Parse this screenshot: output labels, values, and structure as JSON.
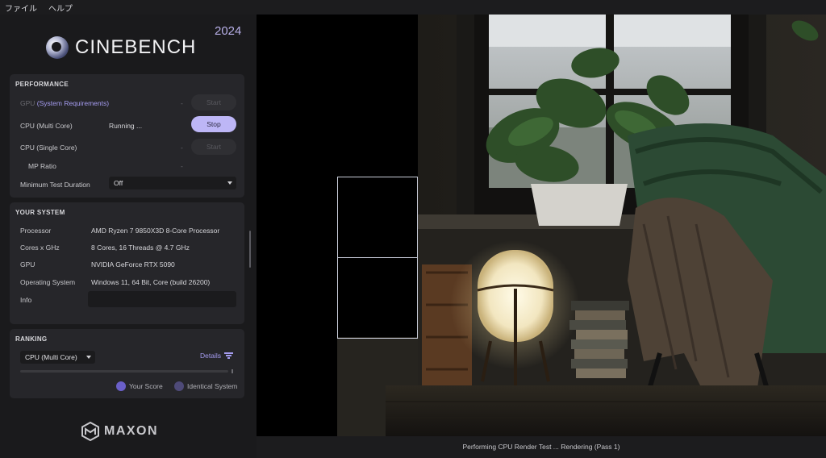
{
  "menu": {
    "items": [
      "ファイル",
      "ヘルプ"
    ]
  },
  "app": {
    "name": "CINEBENCH",
    "year": "2024"
  },
  "performance": {
    "title": "PERFORMANCE",
    "gpu": {
      "label_prefix": "GPU",
      "link": "(System Requirements)",
      "value": "-",
      "button": "Start"
    },
    "cpu_multi": {
      "label": "CPU (Multi Core)",
      "value": "Running ...",
      "button": "Stop"
    },
    "cpu_single": {
      "label": "CPU (Single Core)",
      "value": "-",
      "button": "Start"
    },
    "mp_ratio": {
      "label": "MP Ratio",
      "value": "-"
    },
    "min_duration": {
      "label": "Minimum Test Duration",
      "selected": "Off"
    }
  },
  "system": {
    "title": "YOUR SYSTEM",
    "processor": {
      "label": "Processor",
      "value": "AMD Ryzen 7 9850X3D 8-Core Processor"
    },
    "cores": {
      "label": "Cores x GHz",
      "value": "8 Cores, 16 Threads @ 4.7 GHz"
    },
    "gpu": {
      "label": "GPU",
      "value": "NVIDIA GeForce RTX 5090"
    },
    "os": {
      "label": "Operating System",
      "value": "Windows 11, 64 Bit, Core (build 26200)"
    },
    "info": {
      "label": "Info",
      "value": ""
    }
  },
  "ranking": {
    "title": "RANKING",
    "selected": "CPU (Multi Core)",
    "details": "Details",
    "legend_your": "Your Score",
    "legend_identical": "Identical System",
    "colors": {
      "your_score": "#6a5fc8",
      "identical": "#4e4a78"
    }
  },
  "brand": {
    "footer": "MAXON"
  },
  "status": "Performing CPU Render Test ... Rendering (Pass 1)",
  "colors": {
    "accent": "#bdb6f6",
    "link": "#a59cf0"
  }
}
